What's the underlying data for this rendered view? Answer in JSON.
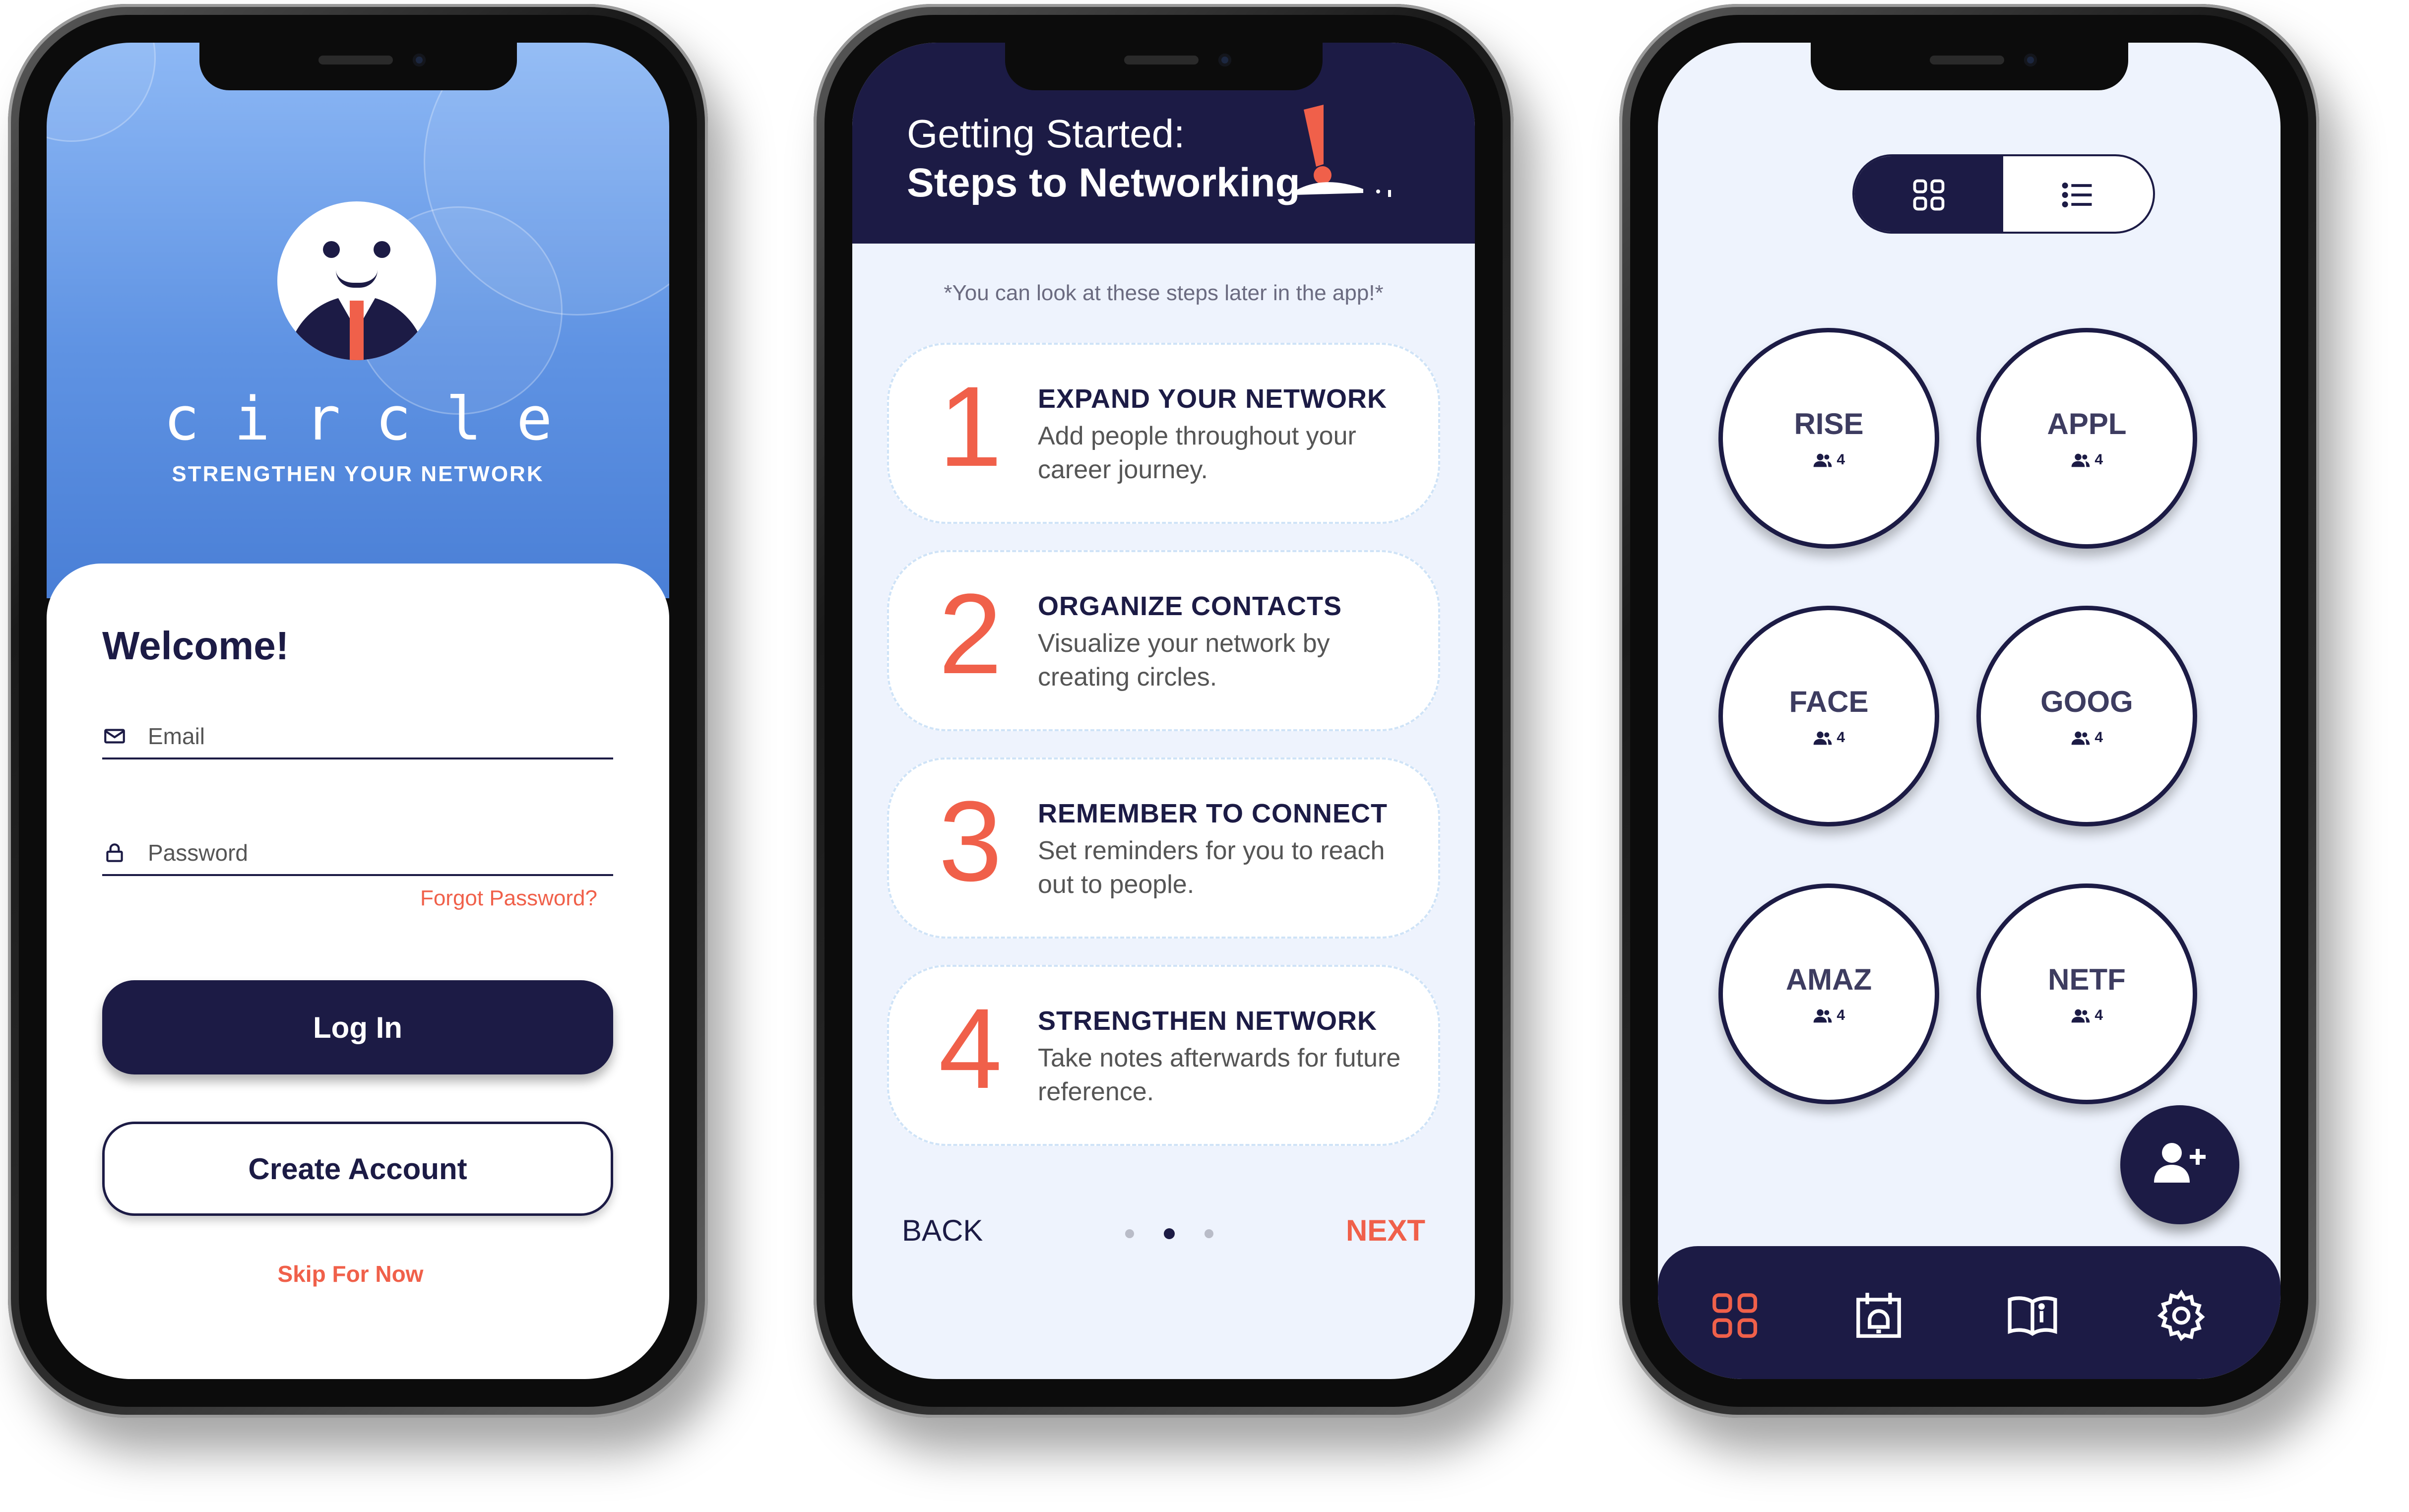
{
  "login": {
    "brand": "circle",
    "tagline": "STRENGTHEN YOUR NETWORK",
    "welcome": "Welcome!",
    "email_placeholder": "Email",
    "password_placeholder": "Password",
    "forgot": "Forgot Password?",
    "login_label": "Log In",
    "create_label": "Create Account",
    "skip_label": "Skip For Now"
  },
  "onboarding": {
    "title_line1": "Getting Started:",
    "title_line2": "Steps to Networking",
    "note": "*You can look at these steps later in the app!*",
    "steps": [
      {
        "num": "1",
        "title": "EXPAND YOUR NETWORK",
        "desc": "Add people throughout your career journey."
      },
      {
        "num": "2",
        "title": "ORGANIZE CONTACTS",
        "desc": "Visualize your network by creating circles."
      },
      {
        "num": "3",
        "title": "REMEMBER TO CONNECT",
        "desc": "Set reminders for you to reach out to people."
      },
      {
        "num": "4",
        "title": "STRENGTHEN NETWORK",
        "desc": "Take notes afterwards for future reference."
      }
    ],
    "back_label": "BACK",
    "next_label": "NEXT",
    "page_dots": {
      "count": 3,
      "active_index": 1
    }
  },
  "circles": {
    "view_mode": "grid",
    "items": [
      {
        "name": "RISE",
        "members": "4"
      },
      {
        "name": "APPL",
        "members": "4"
      },
      {
        "name": "FACE",
        "members": "4"
      },
      {
        "name": "GOOG",
        "members": "4"
      },
      {
        "name": "AMAZ",
        "members": "4"
      },
      {
        "name": "NETF",
        "members": "4"
      }
    ],
    "fab_icon": "add-person-icon",
    "tabs": [
      {
        "icon": "grid-icon",
        "active": true
      },
      {
        "icon": "calendar-alarm-icon",
        "active": false
      },
      {
        "icon": "book-info-icon",
        "active": false
      },
      {
        "icon": "gear-icon",
        "active": false
      }
    ]
  },
  "colors": {
    "navy": "#1c1b45",
    "accent": "#f0604a",
    "blue_top": "#8db8f5",
    "blue_bottom": "#4a7fd6",
    "light_bg": "#eef3fd"
  }
}
